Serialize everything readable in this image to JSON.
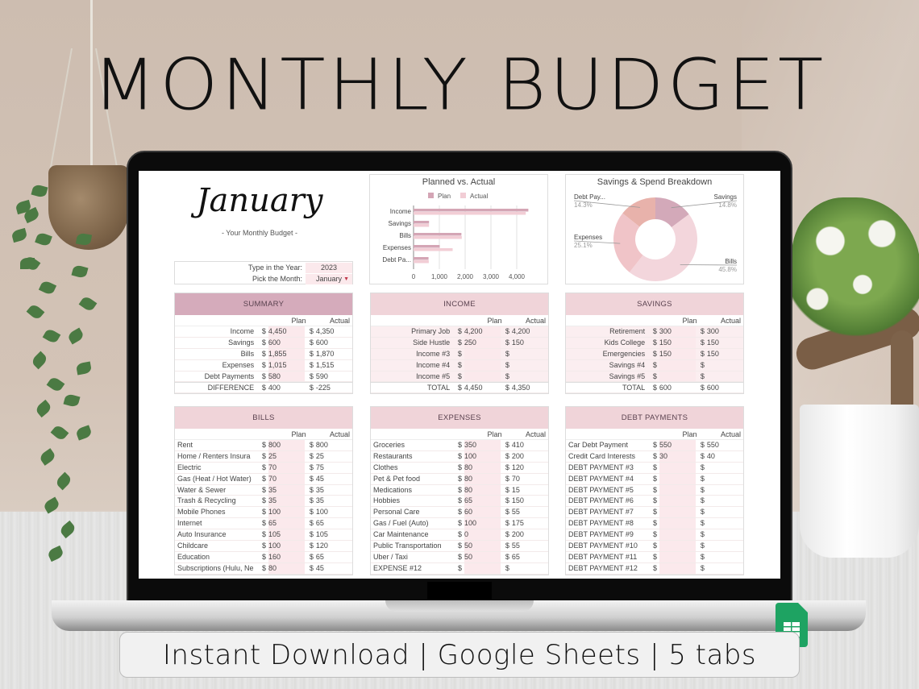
{
  "banner": {
    "title": "MONTHLY BUDGET",
    "caption": "Instant Download | Google Sheets | 5 tabs",
    "app_icon": "google-sheets-icon"
  },
  "sheet": {
    "month_title": "January",
    "subtitle": "- Your Monthly Budget -",
    "year_label": "Type in the Year:",
    "year_value": "2023",
    "month_label": "Pick the Month:",
    "month_value": "January",
    "col_plan": "Plan",
    "col_actual": "Actual",
    "currency": "$"
  },
  "colors": {
    "plan": "#d4a5b5",
    "actual": "#f2cdd5",
    "header_summary": "#d5abbb",
    "header_pink": "#f0d4d9",
    "donut": [
      "#d3a9b9",
      "#f3d6dc",
      "#f0c4c8",
      "#e8b2ab"
    ]
  },
  "chart_data": [
    {
      "type": "bar",
      "orientation": "horizontal",
      "title": "Planned vs. Actual",
      "categories": [
        "Income",
        "Savings",
        "Bills",
        "Expenses",
        "Debt Pa..."
      ],
      "series": [
        {
          "name": "Plan",
          "values": [
            4450,
            600,
            1855,
            1015,
            580
          ]
        },
        {
          "name": "Actual",
          "values": [
            4350,
            600,
            1870,
            1515,
            590
          ]
        }
      ],
      "xticks": [
        "0",
        "1,000",
        "2,000",
        "3,000",
        "4,000"
      ],
      "xlim": [
        0,
        5000
      ],
      "legend": "top",
      "grid": true
    },
    {
      "type": "pie",
      "donut": true,
      "title": "Savings & Spend Breakdown",
      "labels": [
        "Savings",
        "Bills",
        "Expenses",
        "Debt Pay..."
      ],
      "values": [
        14.8,
        45.8,
        25.1,
        14.3
      ],
      "value_labels": [
        "14.8%",
        "45.8%",
        "25.1%",
        "14.3%"
      ]
    }
  ],
  "tables": {
    "summary": {
      "title": "SUMMARY",
      "rows": [
        {
          "label": "Income",
          "plan": "4,450",
          "actual": "4,350"
        },
        {
          "label": "Savings",
          "plan": "600",
          "actual": "600"
        },
        {
          "label": "Bills",
          "plan": "1,855",
          "actual": "1,870"
        },
        {
          "label": "Expenses",
          "plan": "1,015",
          "actual": "1,515"
        },
        {
          "label": "Debt Payments",
          "plan": "580",
          "actual": "590"
        }
      ],
      "total": {
        "label": "DIFFERENCE",
        "plan": "400",
        "actual": "-225"
      }
    },
    "income": {
      "title": "INCOME",
      "rows": [
        {
          "label": "Primary Job",
          "plan": "4,200",
          "actual": "4,200"
        },
        {
          "label": "Side Hustle",
          "plan": "250",
          "actual": "150"
        },
        {
          "label": "Income #3",
          "plan": "",
          "actual": ""
        },
        {
          "label": "Income #4",
          "plan": "",
          "actual": ""
        },
        {
          "label": "Income #5",
          "plan": "",
          "actual": ""
        }
      ],
      "total": {
        "label": "TOTAL",
        "plan": "4,450",
        "actual": "4,350"
      }
    },
    "savings": {
      "title": "SAVINGS",
      "rows": [
        {
          "label": "Retirement",
          "plan": "300",
          "actual": "300"
        },
        {
          "label": "Kids College",
          "plan": "150",
          "actual": "150"
        },
        {
          "label": "Emergencies",
          "plan": "150",
          "actual": "150"
        },
        {
          "label": "Savings #4",
          "plan": "",
          "actual": ""
        },
        {
          "label": "Savings #5",
          "plan": "",
          "actual": ""
        }
      ],
      "total": {
        "label": "TOTAL",
        "plan": "600",
        "actual": "600"
      }
    },
    "bills": {
      "title": "BILLS",
      "rows": [
        {
          "label": "Rent",
          "plan": "800",
          "actual": "800"
        },
        {
          "label": "Home / Renters Insura",
          "plan": "25",
          "actual": "25"
        },
        {
          "label": "Electric",
          "plan": "70",
          "actual": "75"
        },
        {
          "label": "Gas (Heat / Hot Water)",
          "plan": "70",
          "actual": "45"
        },
        {
          "label": "Water & Sewer",
          "plan": "35",
          "actual": "35"
        },
        {
          "label": "Trash & Recycling",
          "plan": "35",
          "actual": "35"
        },
        {
          "label": "Mobile Phones",
          "plan": "100",
          "actual": "100"
        },
        {
          "label": "Internet",
          "plan": "65",
          "actual": "65"
        },
        {
          "label": "Auto Insurance",
          "plan": "105",
          "actual": "105"
        },
        {
          "label": "Childcare",
          "plan": "100",
          "actual": "120"
        },
        {
          "label": "Education",
          "plan": "160",
          "actual": "65"
        },
        {
          "label": "Subscriptions (Hulu, Ne",
          "plan": "80",
          "actual": "45"
        }
      ]
    },
    "expenses": {
      "title": "EXPENSES",
      "rows": [
        {
          "label": "Groceries",
          "plan": "350",
          "actual": "410"
        },
        {
          "label": "Restaurants",
          "plan": "100",
          "actual": "200"
        },
        {
          "label": "Clothes",
          "plan": "80",
          "actual": "120"
        },
        {
          "label": "Pet & Pet food",
          "plan": "80",
          "actual": "70"
        },
        {
          "label": "Medications",
          "plan": "80",
          "actual": "15"
        },
        {
          "label": "Hobbies",
          "plan": "65",
          "actual": "150"
        },
        {
          "label": "Personal Care",
          "plan": "60",
          "actual": "55"
        },
        {
          "label": "Gas / Fuel (Auto)",
          "plan": "100",
          "actual": "175"
        },
        {
          "label": "Car Maintenance",
          "plan": "0",
          "actual": "200"
        },
        {
          "label": "Public Transportation",
          "plan": "50",
          "actual": "55"
        },
        {
          "label": "Uber / Taxi",
          "plan": "50",
          "actual": "65"
        },
        {
          "label": "EXPENSE #12",
          "plan": "",
          "actual": ""
        }
      ]
    },
    "debt": {
      "title": "DEBT PAYMENTS",
      "rows": [
        {
          "label": "Car Debt Payment",
          "plan": "550",
          "actual": "550"
        },
        {
          "label": "Credit Card Interests",
          "plan": "30",
          "actual": "40"
        },
        {
          "label": "DEBT PAYMENT #3",
          "plan": "",
          "actual": ""
        },
        {
          "label": "DEBT PAYMENT #4",
          "plan": "",
          "actual": ""
        },
        {
          "label": "DEBT PAYMENT #5",
          "plan": "",
          "actual": ""
        },
        {
          "label": "DEBT PAYMENT #6",
          "plan": "",
          "actual": ""
        },
        {
          "label": "DEBT PAYMENT #7",
          "plan": "",
          "actual": ""
        },
        {
          "label": "DEBT PAYMENT #8",
          "plan": "",
          "actual": ""
        },
        {
          "label": "DEBT PAYMENT #9",
          "plan": "",
          "actual": ""
        },
        {
          "label": "DEBT PAYMENT #10",
          "plan": "",
          "actual": ""
        },
        {
          "label": "DEBT PAYMENT #11",
          "plan": "",
          "actual": ""
        },
        {
          "label": "DEBT PAYMENT #12",
          "plan": "",
          "actual": ""
        }
      ]
    }
  }
}
